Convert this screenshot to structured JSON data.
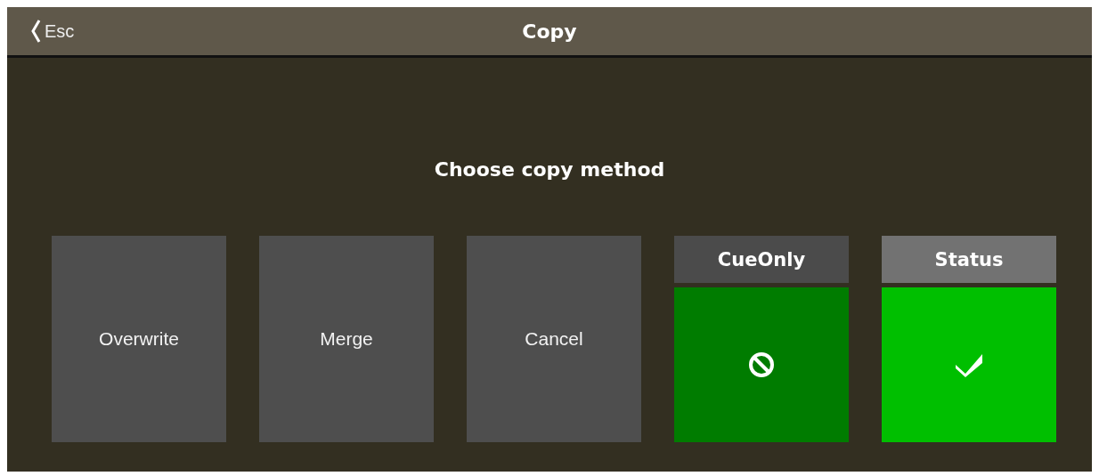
{
  "window": {
    "title": "Copy",
    "back_button": "Esc"
  },
  "prompt": "Choose copy method",
  "actions": [
    {
      "label": "Overwrite"
    },
    {
      "label": "Merge"
    },
    {
      "label": "Cancel"
    }
  ],
  "options": [
    {
      "label": "CueOnly",
      "on": false
    },
    {
      "label": "Status",
      "on": true
    }
  ]
}
